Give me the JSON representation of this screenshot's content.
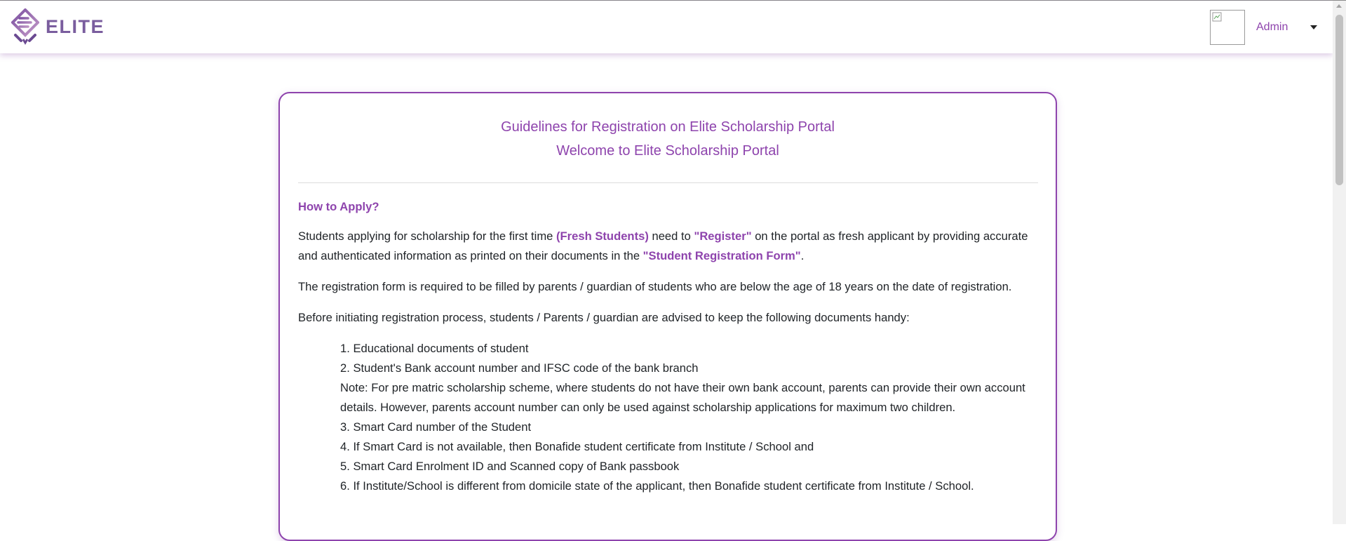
{
  "brand": {
    "name": "ELITE",
    "logo_icon": "elite-logo-icon"
  },
  "header": {
    "user_name": "Admin",
    "avatar_icon": "broken-image-icon",
    "dropdown_icon": "caret-down-icon"
  },
  "guidelines": {
    "title": "Guidelines for Registration on Elite Scholarship Portal",
    "subtitle": "Welcome to Elite Scholarship Portal",
    "section_heading": "How to Apply?",
    "para1": {
      "a": "Students applying for scholarship for the first time ",
      "fresh": "(Fresh Students)",
      "b": " need to ",
      "register": "\"Register\"",
      "c": " on the portal as fresh applicant by providing accurate and authenticated information as printed on their documents in the ",
      "form": "\"Student Registration Form\"",
      "d": "."
    },
    "para2": "The registration form is required to be filled by parents / guardian of students who are below the age of 18 years on the date of registration.",
    "para3": "Before initiating registration process, students / Parents / guardian are advised to keep the following documents handy:",
    "documents": [
      "1. Educational documents of student",
      "2. Student's Bank account number and IFSC code of the bank branch",
      "Note: For pre matric scholarship scheme, where students do not have their own bank account, parents can provide their own account details. However, parents account number can only be used against scholarship applications for maximum two children.",
      "3. Smart Card number of the Student",
      "4. If Smart Card is not available, then Bonafide student certificate from Institute / School and",
      "5. Smart Card Enrolment ID and Scanned copy of Bank passbook",
      "6. If Institute/School is different from domicile state of the applicant, then Bonafide student certificate from Institute / School."
    ]
  },
  "colors": {
    "accent": "#8e44ad",
    "logo": "#7a5d9e",
    "text": "#212529"
  }
}
